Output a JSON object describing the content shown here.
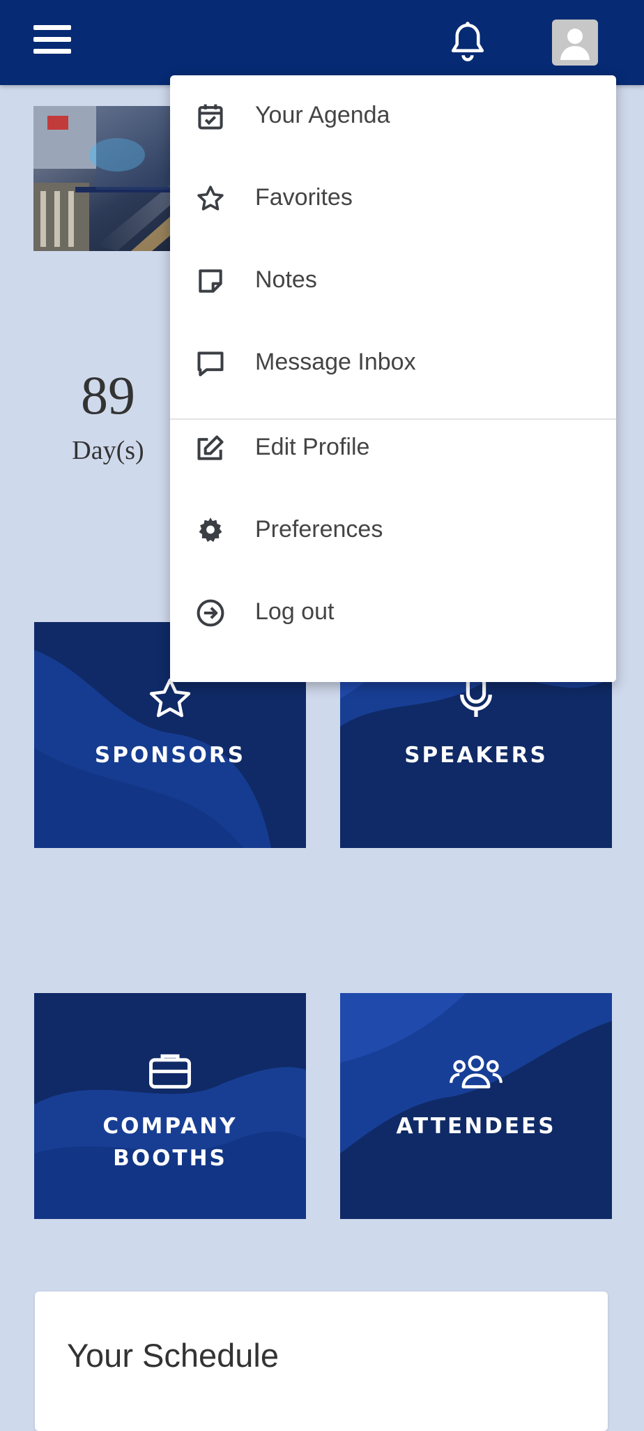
{
  "header": {
    "menu_icon": "hamburger-menu-icon",
    "notifications_icon": "bell-icon",
    "profile_icon": "user-avatar-icon"
  },
  "countdown": {
    "value": "89",
    "unit": "Day(s)"
  },
  "tiles": [
    {
      "label": "SPONSORS",
      "icon": "star-icon"
    },
    {
      "label": "SPEAKERS",
      "icon": "microphone-icon"
    },
    {
      "label": "COMPANY\nBOOTHS",
      "icon": "briefcase-icon"
    },
    {
      "label": "ATTENDEES",
      "icon": "users-icon"
    }
  ],
  "schedule": {
    "title": "Your Schedule"
  },
  "user_menu": {
    "items": [
      {
        "label": "Your Agenda",
        "icon": "calendar-check-icon"
      },
      {
        "label": "Favorites",
        "icon": "star-outline-icon"
      },
      {
        "label": "Notes",
        "icon": "sticky-note-icon"
      },
      {
        "label": "Message Inbox",
        "icon": "message-square-icon"
      },
      {
        "label": "Edit Profile",
        "icon": "edit-icon"
      },
      {
        "label": "Preferences",
        "icon": "gear-icon"
      },
      {
        "label": "Log out",
        "icon": "logout-icon"
      }
    ]
  },
  "colors": {
    "header_bg": "#062a73",
    "page_bg": "#cfd9ec",
    "tile_dark": "#0f2a66",
    "tile_wave": "#1a43a0",
    "menu_text": "#444444"
  }
}
